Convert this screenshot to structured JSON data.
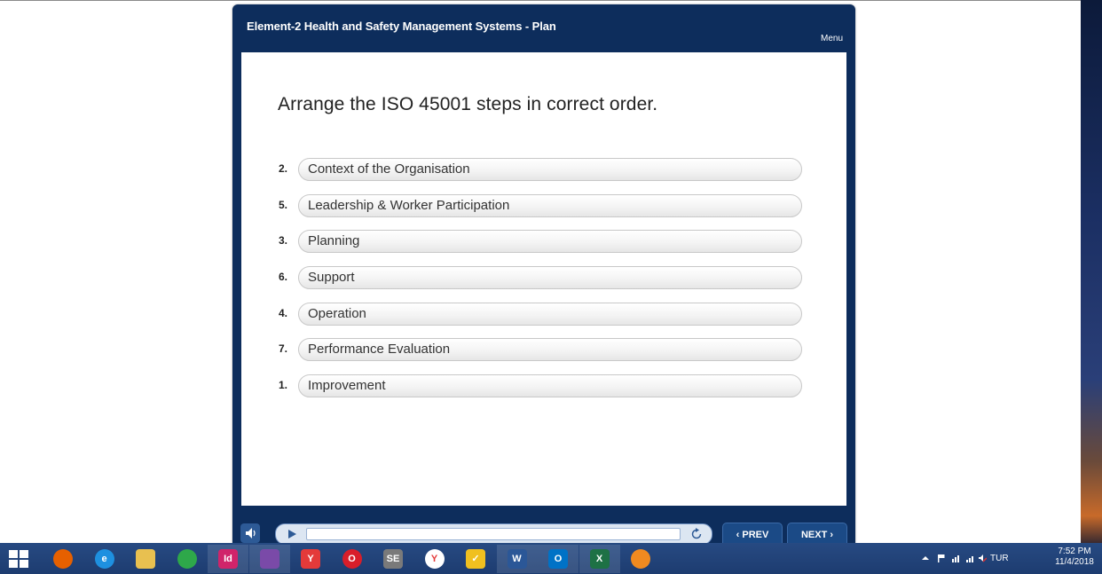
{
  "course": {
    "title": "Element-2 Health and Safety Management Systems - Plan",
    "menu_label": "Menu"
  },
  "slide": {
    "question": "Arrange the ISO 45001 steps in correct order.",
    "items": [
      {
        "number": "2.",
        "label": "Context of the Organisation"
      },
      {
        "number": "5.",
        "label": "Leadership & Worker Participation"
      },
      {
        "number": "3.",
        "label": "Planning"
      },
      {
        "number": "6.",
        "label": "Support"
      },
      {
        "number": "4.",
        "label": "Operation"
      },
      {
        "number": "7.",
        "label": "Performance Evaluation"
      },
      {
        "number": "1.",
        "label": "Improvement"
      }
    ]
  },
  "controls": {
    "prev_label": "‹ PREV",
    "next_label": "NEXT ›",
    "volume_icon": "speaker-icon",
    "play_icon": "play-icon",
    "replay_icon": "replay-icon"
  },
  "taskbar": {
    "apps": [
      {
        "name": "firefox",
        "icon": "firefox-icon",
        "color": "#e66000",
        "glyph": ""
      },
      {
        "name": "internet-explorer",
        "icon": "ie-icon",
        "color": "#1e90e0",
        "glyph": "e"
      },
      {
        "name": "file-explorer",
        "icon": "folder-icon",
        "color": "#e8c050",
        "glyph": ""
      },
      {
        "name": "chrome",
        "icon": "chrome-icon",
        "color": "#2ea84a",
        "glyph": ""
      },
      {
        "name": "indesign",
        "icon": "indesign-icon",
        "color": "#d0246a",
        "glyph": "Id"
      },
      {
        "name": "save-app",
        "icon": "floppy-icon",
        "color": "#7a4aa8",
        "glyph": ""
      },
      {
        "name": "yandex",
        "icon": "yandex-icon",
        "color": "#e43a3a",
        "glyph": "Y"
      },
      {
        "name": "opera",
        "icon": "opera-icon",
        "color": "#d81e2a",
        "glyph": "O"
      },
      {
        "name": "se-app",
        "icon": "se-icon",
        "color": "#7a7a7a",
        "glyph": "SE"
      },
      {
        "name": "yandex-browser",
        "icon": "yandex-browser-icon",
        "color": "#ffffff",
        "glyph": "Y"
      },
      {
        "name": "norton",
        "icon": "checkmark-icon",
        "color": "#f0c020",
        "glyph": "✓"
      },
      {
        "name": "word",
        "icon": "word-icon",
        "color": "#2b5797",
        "glyph": "W"
      },
      {
        "name": "outlook",
        "icon": "outlook-icon",
        "color": "#0072c6",
        "glyph": "O"
      },
      {
        "name": "excel",
        "icon": "excel-icon",
        "color": "#1e7145",
        "glyph": "X"
      },
      {
        "name": "player",
        "icon": "player-app-icon",
        "color": "#f08a20",
        "glyph": ""
      }
    ],
    "tray": {
      "language": "TUR",
      "time": "7:52 PM",
      "date": "11/4/2018"
    }
  }
}
